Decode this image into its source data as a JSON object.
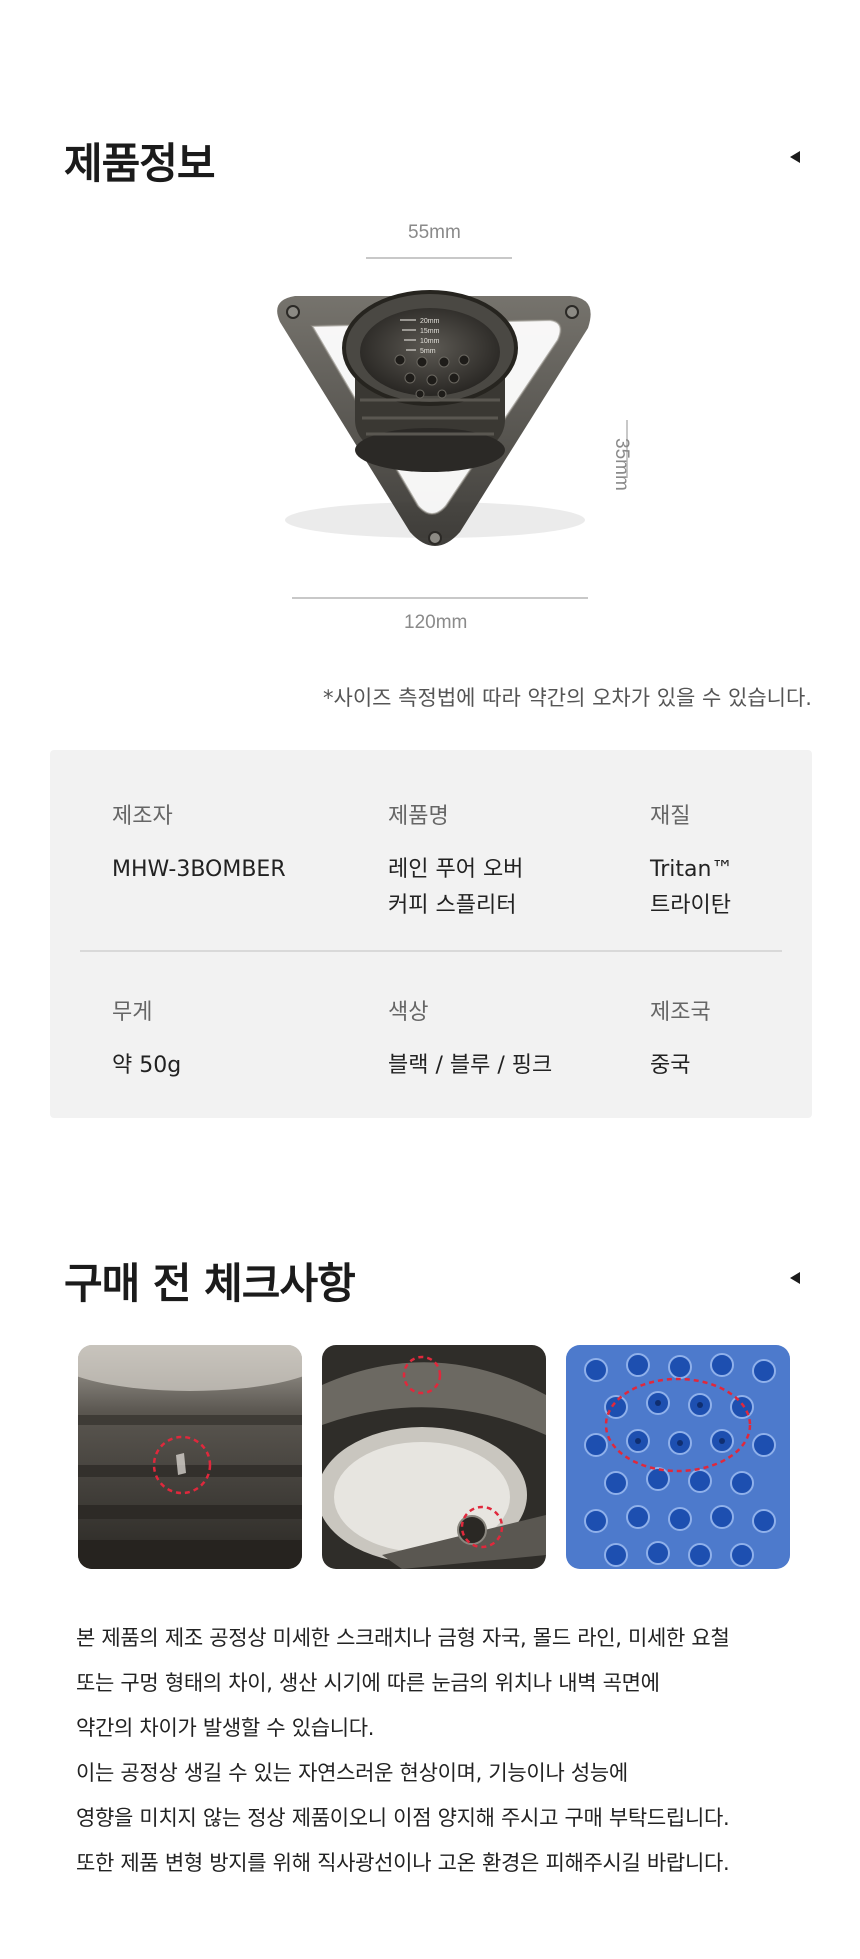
{
  "product_info": {
    "title": "제품정보",
    "dimensions": {
      "width_label": "55mm",
      "height_label": "35mm",
      "length_label": "120mm"
    },
    "size_note": "*사이즈 측정법에 따라 약간의 오차가 있을 수 있습니다.",
    "ruler_marks": [
      "20mm",
      "15mm",
      "10mm",
      "5mm"
    ],
    "specs": [
      {
        "label": "제조자",
        "value": "MHW-3BOMBER"
      },
      {
        "label": "제품명",
        "value": "레인 푸어 오버\n커피 스플리터"
      },
      {
        "label": "재질",
        "value": "Tritan™\n트라이탄"
      },
      {
        "label": "무게",
        "value": "약 50g"
      },
      {
        "label": "색상",
        "value": "블랙 / 블루 / 핑크"
      },
      {
        "label": "제조국",
        "value": "중국"
      }
    ]
  },
  "purchase_check": {
    "title": "구매 전 체크사항",
    "notice_lines": [
      "본 제품의 제조 공정상 미세한 스크래치나 금형 자국, 몰드 라인, 미세한 요철",
      "또는 구멍 형태의 차이, 생산 시기에 따른 눈금의 위치나 내벽 곡면에",
      "약간의 차이가 발생할 수 있습니다.",
      "이는 공정상 생길 수 있는 자연스러운 현상이며, 기능이나 성능에",
      "영향을 미치지 않는 정상 제품이오니 이점 양지해 주시고 구매 부탁드립니다.",
      "또한 제품 변형 방지를 위해 직사광선이나 고온 환경은 피해주시길 바랍니다."
    ]
  },
  "colors": {
    "spec_box_bg": "#f2f2f2",
    "product_smoke": "#3a3833",
    "highlight_circle": "#e0283c",
    "photo_blue": "#2f66c8"
  }
}
